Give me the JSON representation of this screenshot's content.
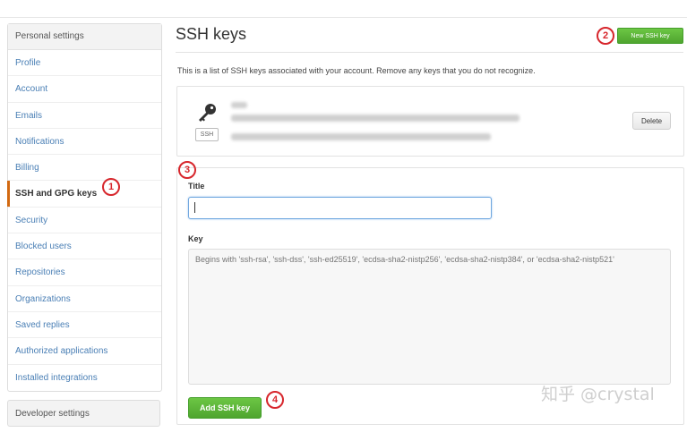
{
  "sidebar": {
    "header": "Personal settings",
    "items": [
      {
        "label": "Profile"
      },
      {
        "label": "Account"
      },
      {
        "label": "Emails"
      },
      {
        "label": "Notifications"
      },
      {
        "label": "Billing"
      },
      {
        "label": "SSH and GPG keys",
        "active": true
      },
      {
        "label": "Security"
      },
      {
        "label": "Blocked users"
      },
      {
        "label": "Repositories"
      },
      {
        "label": "Organizations"
      },
      {
        "label": "Saved replies"
      },
      {
        "label": "Authorized applications"
      },
      {
        "label": "Installed integrations"
      }
    ],
    "developer_header": "Developer settings"
  },
  "main": {
    "title": "SSH keys",
    "new_key_button": "New SSH key",
    "description": "This is a list of SSH keys associated with your account. Remove any keys that you do not recognize.",
    "key_entry": {
      "icon": "key-icon",
      "badge": "SSH",
      "delete_button": "Delete"
    },
    "form": {
      "title_label": "Title",
      "title_value": "",
      "key_label": "Key",
      "key_placeholder": "Begins with 'ssh-rsa', 'ssh-dss', 'ssh-ed25519', 'ecdsa-sha2-nistp256', 'ecdsa-sha2-nistp384', or 'ecdsa-sha2-nistp521'",
      "add_button": "Add SSH key"
    }
  },
  "annotations": {
    "step1": "1",
    "step2": "2",
    "step3": "3",
    "step4": "4",
    "color": "#d7262c"
  },
  "watermark": "知乎 @crystal",
  "colors": {
    "accent_green": "#6cc644",
    "active_marker": "#d26911",
    "link": "#4a7fb5"
  }
}
